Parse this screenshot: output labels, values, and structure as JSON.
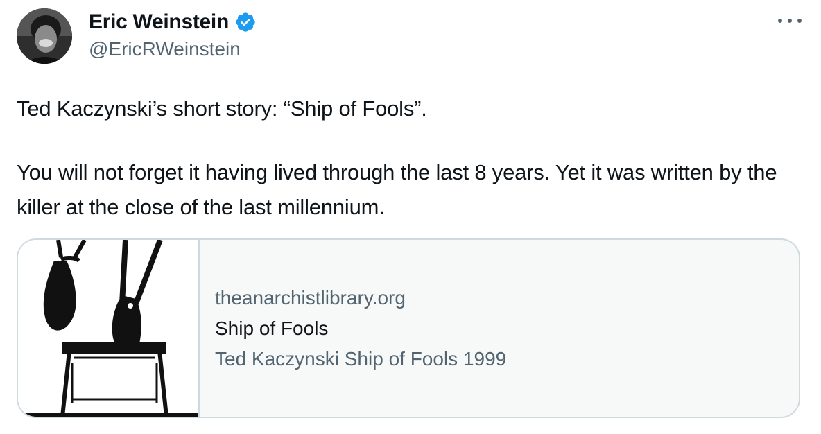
{
  "author": {
    "display_name": "Eric Weinstein",
    "handle": "@EricRWeinstein",
    "verified_icon": "verified-badge-icon",
    "verified_color": "#1d9bf0"
  },
  "menu_icon": "more-horizontal-icon",
  "tweet": {
    "paragraphs": [
      "Ted Kaczynski’s short story: “Ship of Fools”.",
      "You will not forget it having lived through the last 8 years. Yet it was written by the killer at the close of the last millennium."
    ]
  },
  "card": {
    "domain": "theanarchistlibrary.org",
    "title": "Ship of Fools",
    "description": "Ted Kaczynski Ship of Fools 1999",
    "image_icon": "hanging-figure-illustration"
  },
  "colors": {
    "text_primary": "#0f1419",
    "text_secondary": "#536471",
    "border": "#cfd9de",
    "card_bg": "#f7f9f9"
  }
}
